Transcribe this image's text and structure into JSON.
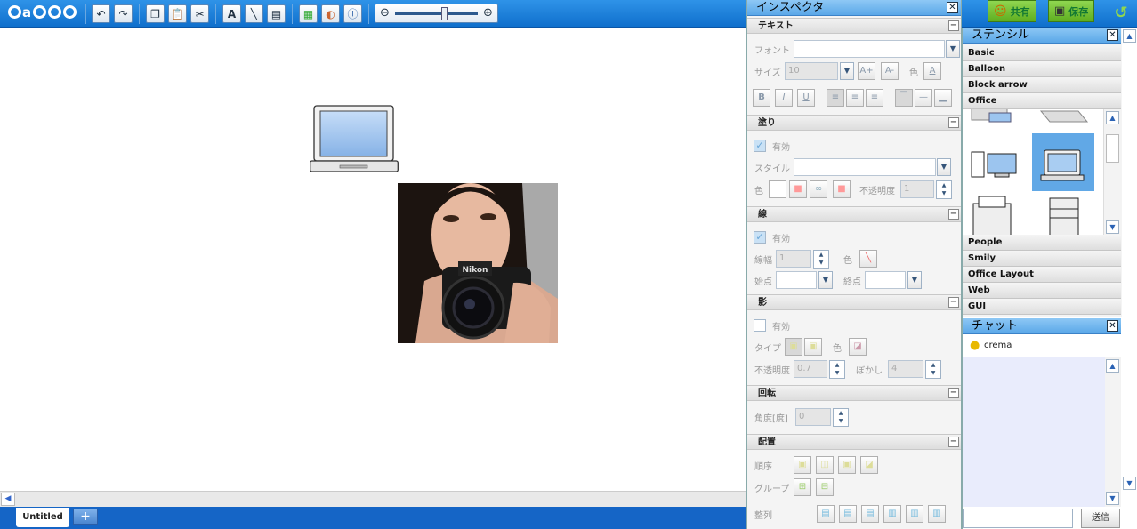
{
  "app": {
    "logo_text": "cacoo"
  },
  "toolbar": {
    "share_label": "共有",
    "save_label": "保存",
    "icons": [
      "undo-icon",
      "redo-icon",
      "copy-icon",
      "paste-icon",
      "cut-icon",
      "text-tool-icon",
      "line-tool-icon",
      "image-tool-icon",
      "stencil-icon",
      "color-icon",
      "info-icon",
      "zoom-out-icon",
      "zoom-in-icon"
    ]
  },
  "tabs": [
    {
      "label": "Untitled"
    }
  ],
  "tab_add": "+",
  "inspector": {
    "title": "インスペクタ",
    "close": "✕",
    "text": {
      "title": "テキスト",
      "font_label": "フォント",
      "size_label": "サイズ",
      "size_value": "10",
      "color_label": "色",
      "size_up": "A+",
      "size_down": "A-",
      "color_glyph": "A",
      "bold": "B",
      "italic": "I",
      "underline": "U"
    },
    "fill": {
      "title": "塗り",
      "enabled_label": "有効",
      "style_label": "スタイル",
      "color_label": "色",
      "opacity_label": "不透明度",
      "opacity_value": "1"
    },
    "line": {
      "title": "線",
      "enabled_label": "有効",
      "width_label": "線幅",
      "width_value": "1",
      "color_label": "色",
      "start_label": "始点",
      "end_label": "終点"
    },
    "shadow": {
      "title": "影",
      "enabled_label": "有効",
      "type_label": "タイプ",
      "color_label": "色",
      "opacity_label": "不透明度",
      "opacity_value": "0.7",
      "blur_label": "ぼかし",
      "blur_value": "4"
    },
    "rotate": {
      "title": "回転",
      "angle_label": "角度[度]",
      "angle_value": "0"
    },
    "arrange": {
      "title": "配置",
      "order_label": "順序",
      "group_label": "グループ",
      "align_label": "整列"
    }
  },
  "stencil": {
    "title": "ステンシル",
    "close": "✕",
    "categories_top": [
      "Basic",
      "Balloon",
      "Block arrow",
      "Office"
    ],
    "categories_bottom": [
      "People",
      "Smily",
      "Office Layout",
      "Web",
      "GUI"
    ]
  },
  "chat": {
    "title": "チャット",
    "close": "✕",
    "user": "crema",
    "send_label": "送信"
  }
}
